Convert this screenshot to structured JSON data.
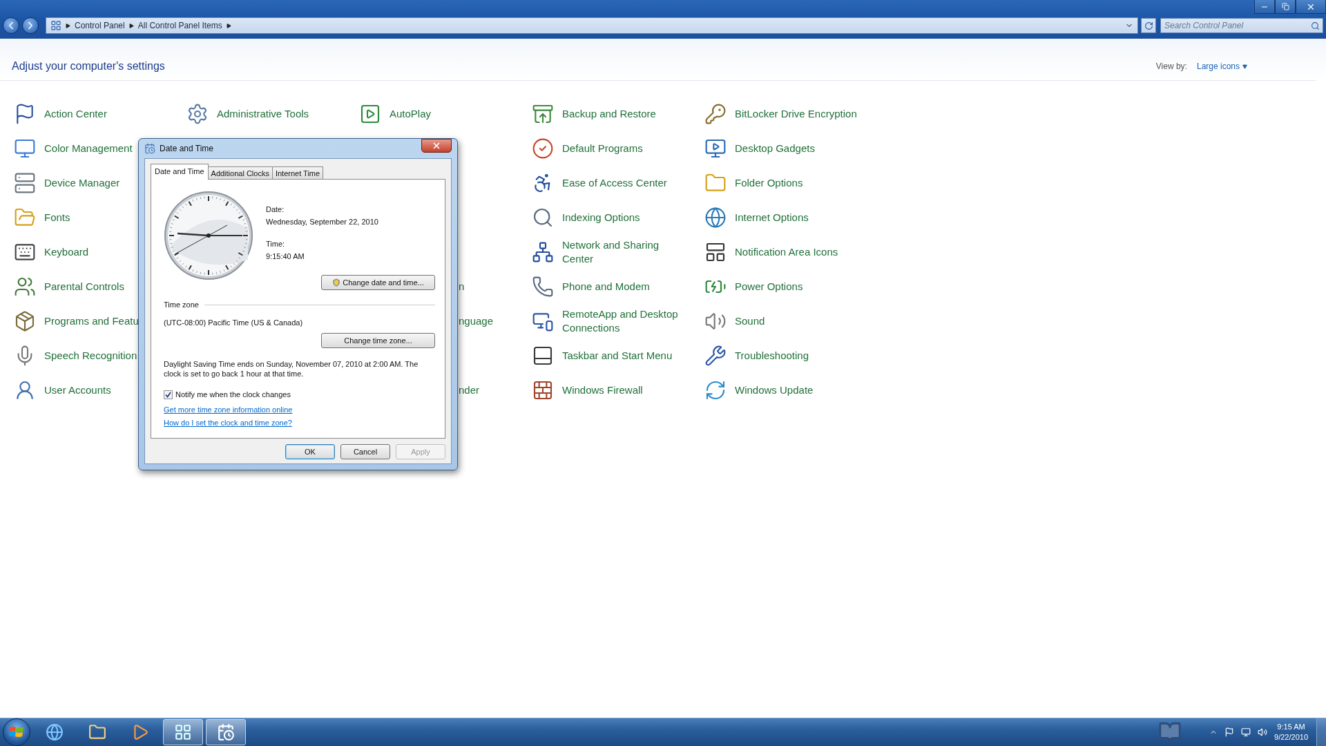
{
  "address_bar": {
    "breadcrumb": [
      "Control Panel",
      "All Control Panel Items"
    ]
  },
  "search": {
    "placeholder": "Search Control Panel"
  },
  "header": {
    "title": "Adjust your computer's settings",
    "view_by_label": "View by:",
    "view_by_value": "Large icons"
  },
  "columns": [
    [
      {
        "kind": "item",
        "label": "Action Center"
      },
      {
        "kind": "item",
        "label": "Color Management"
      },
      {
        "kind": "item",
        "label": "Device Manager"
      },
      {
        "kind": "item",
        "label": "Fonts"
      },
      {
        "kind": "item",
        "label": "Keyboard"
      },
      {
        "kind": "item",
        "label": "Parental Controls"
      },
      {
        "kind": "item",
        "label": "Programs and Featu"
      },
      {
        "kind": "item",
        "label": "Speech Recognition"
      },
      {
        "kind": "item",
        "label": "User Accounts"
      }
    ],
    [
      {
        "kind": "item",
        "label": "Administrative Tools"
      },
      {
        "kind": "covered"
      },
      {
        "kind": "covered"
      },
      {
        "kind": "covered"
      },
      {
        "kind": "covered"
      },
      {
        "kind": "covered"
      },
      {
        "kind": "covered"
      },
      {
        "kind": "covered"
      },
      {
        "kind": "covered"
      }
    ],
    [
      {
        "kind": "item",
        "label": "AutoPlay"
      },
      {
        "kind": "covered"
      },
      {
        "kind": "covered"
      },
      {
        "kind": "covered"
      },
      {
        "kind": "covered"
      },
      {
        "kind": "fragment",
        "label": "n"
      },
      {
        "kind": "fragment",
        "label": "nguage"
      },
      {
        "kind": "covered"
      },
      {
        "kind": "fragment",
        "label": "nder"
      }
    ],
    [
      {
        "kind": "item",
        "label": "Backup and Restore"
      },
      {
        "kind": "item",
        "label": "Default Programs"
      },
      {
        "kind": "item",
        "label": "Ease of Access Center"
      },
      {
        "kind": "item",
        "label": "Indexing Options"
      },
      {
        "kind": "item",
        "label": "Network and Sharing Center"
      },
      {
        "kind": "item",
        "label": "Phone and Modem"
      },
      {
        "kind": "item",
        "label": "RemoteApp and Desktop Connections"
      },
      {
        "kind": "item",
        "label": "Taskbar and Start Menu"
      },
      {
        "kind": "item",
        "label": "Windows Firewall"
      }
    ],
    [
      {
        "kind": "item",
        "label": "BitLocker Drive Encryption"
      },
      {
        "kind": "item",
        "label": "Desktop Gadgets"
      },
      {
        "kind": "item",
        "label": "Folder Options"
      },
      {
        "kind": "item",
        "label": "Internet Options"
      },
      {
        "kind": "item",
        "label": "Notification Area Icons"
      },
      {
        "kind": "item",
        "label": "Power Options"
      },
      {
        "kind": "item",
        "label": "Sound"
      },
      {
        "kind": "item",
        "label": "Troubleshooting"
      },
      {
        "kind": "item",
        "label": "Windows Update"
      }
    ]
  ],
  "dialog": {
    "title": "Date and Time",
    "tabs": [
      {
        "label": "Date and Time",
        "selected": true
      },
      {
        "label": "Additional Clocks",
        "selected": false
      },
      {
        "label": "Internet Time",
        "selected": false
      }
    ],
    "date_label": "Date:",
    "date": "Wednesday, September 22, 2010",
    "time_label": "Time:",
    "time": "9:15:40 AM",
    "change_datetime_button": "Change date and time...",
    "timezone_heading": "Time zone",
    "timezone": "(UTC-08:00) Pacific Time (US & Canada)",
    "change_timezone_button": "Change time zone...",
    "dst_note": "Daylight Saving Time ends on Sunday, November 07, 2010 at 2:00 AM. The clock is set to go back 1 hour at that time.",
    "notify": {
      "label": "Notify me when the clock changes",
      "checked": true
    },
    "links": [
      "Get more time zone information online",
      "How do I set the clock and time zone?"
    ],
    "buttons": [
      {
        "label": "OK",
        "default": true,
        "disabled": false
      },
      {
        "label": "Cancel",
        "default": false,
        "disabled": false
      },
      {
        "label": "Apply",
        "default": false,
        "disabled": true
      }
    ]
  },
  "taskbar": {
    "apps": [
      {
        "active": false
      },
      {
        "active": false
      },
      {
        "active": false
      },
      {
        "active": true
      },
      {
        "active": true
      }
    ],
    "clock_time": "9:15 AM",
    "clock_date": "9/22/2010"
  }
}
